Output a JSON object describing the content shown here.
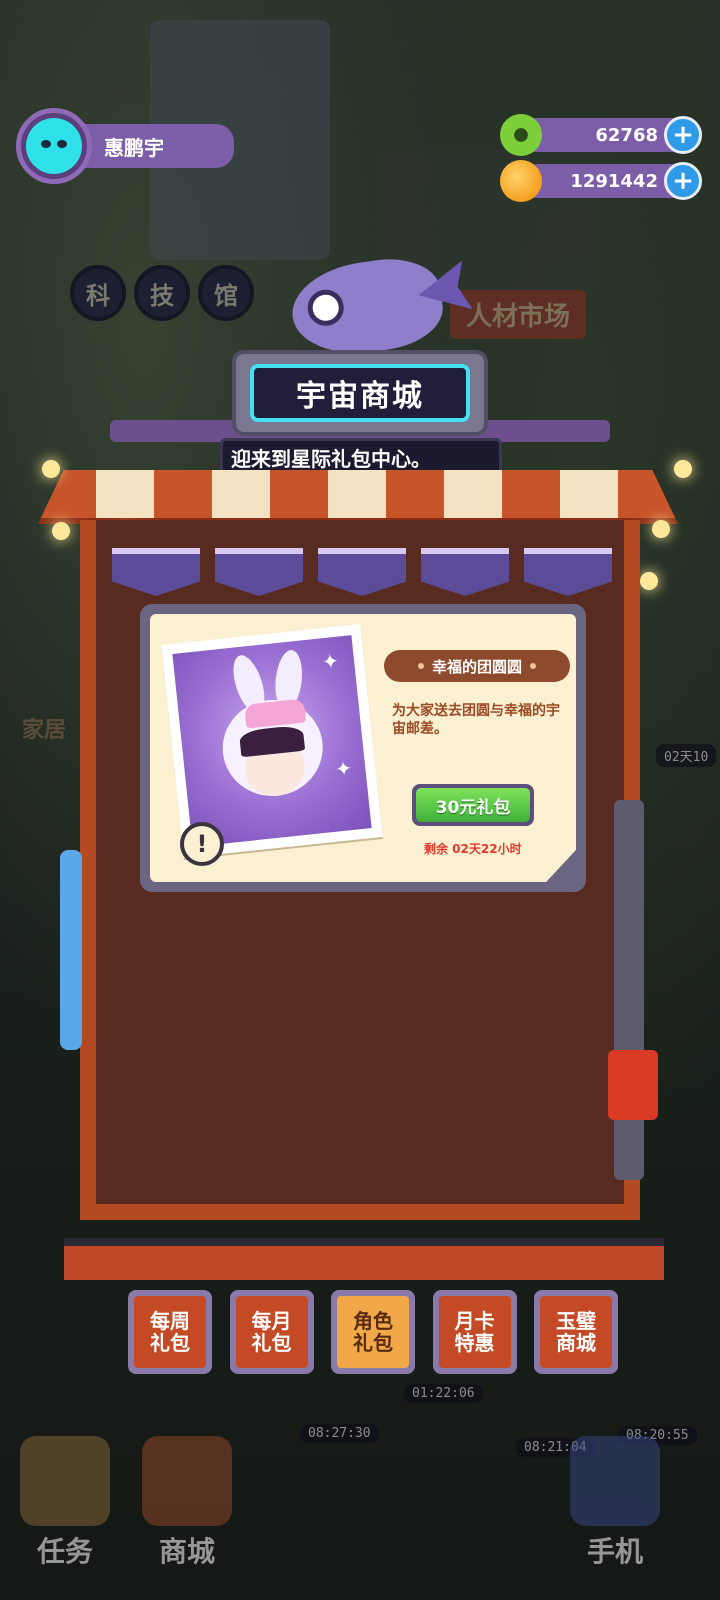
{
  "player": {
    "name": "惠鹏宇"
  },
  "currencies": [
    {
      "name": "donut",
      "value": "62768",
      "color": "#7ccf3a"
    },
    {
      "name": "planet-coin",
      "value": "1291442",
      "color": "#f4a020"
    }
  ],
  "background": {
    "kejiguan": [
      "科",
      "技",
      "馆"
    ],
    "rencai_sign": "人材市场",
    "side_label": "家居",
    "timers": [
      "02天10",
      "01:22:06",
      "08:27:30",
      "08:21:04",
      "08:20:55"
    ]
  },
  "shop": {
    "title": "宇宙商城",
    "marquee": "迎来到星际礼包中心。"
  },
  "package": {
    "name": "幸福的团圆圆",
    "description": "为大家送去团圆与幸福的宇宙邮差。",
    "price_label": "30元礼包",
    "remaining": "剩余 02天22小时"
  },
  "tabs": [
    {
      "label": "每周\n礼包",
      "active": false
    },
    {
      "label": "每月\n礼包",
      "active": false
    },
    {
      "label": "角色\n礼包",
      "active": true
    },
    {
      "label": "月卡\n特惠",
      "active": false
    },
    {
      "label": "玉璧\n商城",
      "active": false
    }
  ],
  "bottom_nav": {
    "tasks": "任务",
    "shop": "商城",
    "phone": "手机"
  },
  "colors": {
    "accent_purple": "#7c5ea8",
    "cabinet_red": "#b34a22",
    "title_cyan": "#45e0f2",
    "buy_green": "#3fb03a"
  }
}
